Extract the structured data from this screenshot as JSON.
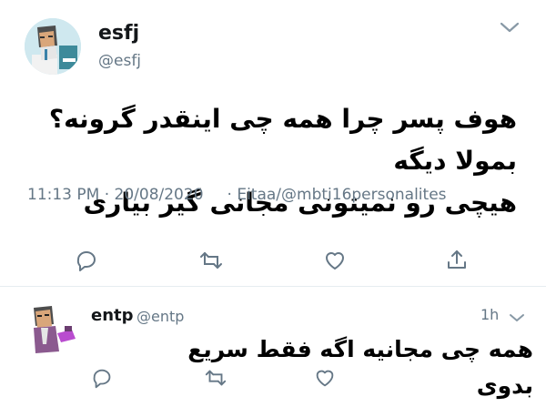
{
  "main_tweet": {
    "name": "esfj",
    "handle": "@esfj",
    "text_line1": "هوف پسر چرا همه چی اینقدر گرونه؟ بمولا دیگه",
    "text_line2": "هیچی رو نمیتونی مجانی گیر بیاری",
    "time": "11:13 PM · 20/08/2020",
    "source": "· Eitaa/@mbti16personalites",
    "icons": {
      "reply": "reply-icon",
      "retweet": "retweet-icon",
      "like": "heart-icon",
      "share": "share-icon",
      "menu": "chevron-down-icon"
    }
  },
  "reply_tweet": {
    "name": "entp",
    "handle": "@entp",
    "time": "1h",
    "text": "همه چی مجانیه اگه فقط سریع بدوی",
    "icons": {
      "reply": "reply-icon",
      "retweet": "retweet-icon",
      "like": "heart-icon",
      "menu": "chevron-down-icon"
    }
  },
  "colors": {
    "text": "#14171a",
    "secondary": "#657786",
    "divider": "#e6ecf0",
    "icon": "#657786"
  }
}
